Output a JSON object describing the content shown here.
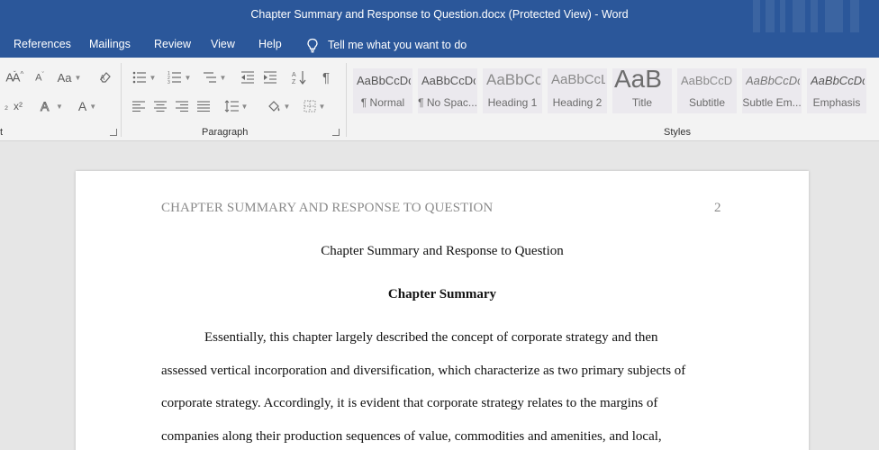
{
  "window": {
    "title": "Chapter Summary and Response to Question.docx (Protected View)  -  Word"
  },
  "menu": {
    "tabs": [
      "References",
      "Mailings",
      "Review",
      "View",
      "Help"
    ],
    "tell_me": "Tell me what you want to do"
  },
  "ribbon": {
    "groups": {
      "font_partial": "t",
      "paragraph": "Paragraph",
      "styles": "Styles"
    },
    "font_buttons": {
      "change_case": "Aa",
      "font_color": "A"
    },
    "styles": [
      {
        "sample": "AaBbCcDc",
        "name": "¶ Normal"
      },
      {
        "sample": "AaBbCcDc",
        "name": "¶ No Spac..."
      },
      {
        "sample": "AaBbCc",
        "name": "Heading 1"
      },
      {
        "sample": "AaBbCcL",
        "name": "Heading 2"
      },
      {
        "sample": "AaB",
        "name": "Title"
      },
      {
        "sample": "AaBbCcD",
        "name": "Subtitle"
      },
      {
        "sample": "AaBbCcDc",
        "name": "Subtle Em..."
      },
      {
        "sample": "AaBbCcDc",
        "name": "Emphasis"
      }
    ]
  },
  "document": {
    "running_head": "CHAPTER SUMMARY AND RESPONSE TO QUESTION",
    "page_number": "2",
    "title": "Chapter Summary and Response to Question",
    "heading": "Chapter Summary",
    "lines": [
      "Essentially, this chapter largely described the concept of corporate strategy and then",
      "assessed vertical incorporation and diversification, which characterize as two primary subjects of",
      "corporate strategy. Accordingly, it is evident that corporate strategy relates to the margins of",
      "companies along their production sequences of value, commodities and amenities, and local,"
    ]
  }
}
